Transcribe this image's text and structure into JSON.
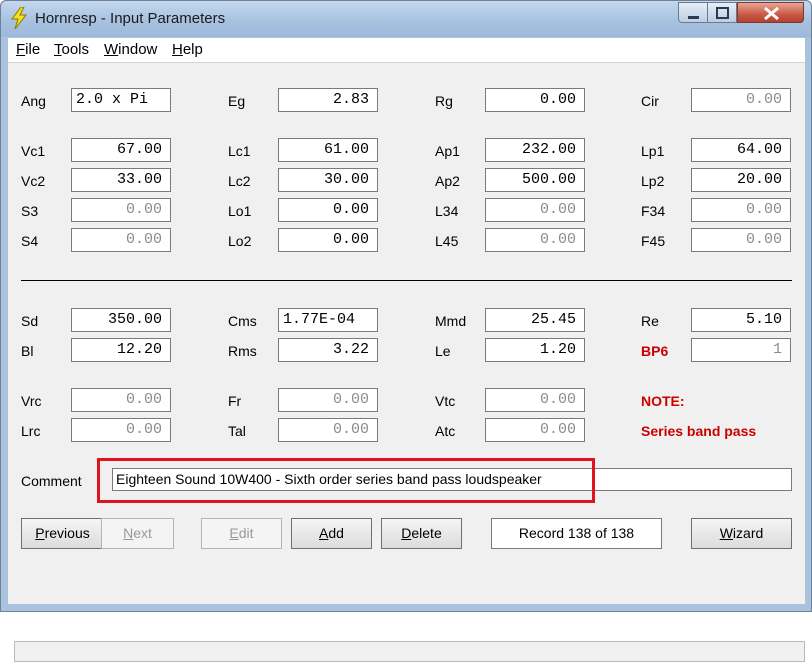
{
  "window": {
    "title": "Hornresp - Input Parameters"
  },
  "menu": [
    {
      "accel": "F",
      "rest": "ile"
    },
    {
      "accel": "T",
      "rest": "ools"
    },
    {
      "accel": "W",
      "rest": "indow"
    },
    {
      "accel": "H",
      "rest": "elp"
    }
  ],
  "params": {
    "Ang": {
      "label": "Ang",
      "value": "2.0 x Pi"
    },
    "Eg": {
      "label": "Eg",
      "value": "2.83"
    },
    "Rg": {
      "label": "Rg",
      "value": "0.00"
    },
    "Cir": {
      "label": "Cir",
      "value": "0.00"
    },
    "Vc1": {
      "label": "Vc1",
      "value": "67.00"
    },
    "Lc1": {
      "label": "Lc1",
      "value": "61.00"
    },
    "Ap1": {
      "label": "Ap1",
      "value": "232.00"
    },
    "Lp1": {
      "label": "Lp1",
      "value": "64.00"
    },
    "Vc2": {
      "label": "Vc2",
      "value": "33.00"
    },
    "Lc2": {
      "label": "Lc2",
      "value": "30.00"
    },
    "Ap2": {
      "label": "Ap2",
      "value": "500.00"
    },
    "Lp2": {
      "label": "Lp2",
      "value": "20.00"
    },
    "S3": {
      "label": "S3",
      "value": "0.00"
    },
    "Lo1": {
      "label": "Lo1",
      "value": "0.00"
    },
    "L34": {
      "label": "L34",
      "value": "0.00"
    },
    "F34": {
      "label": "F34",
      "value": "0.00"
    },
    "S4": {
      "label": "S4",
      "value": "0.00"
    },
    "Lo2": {
      "label": "Lo2",
      "value": "0.00"
    },
    "L45": {
      "label": "L45",
      "value": "0.00"
    },
    "F45": {
      "label": "F45",
      "value": "0.00"
    },
    "Sd": {
      "label": "Sd",
      "value": "350.00"
    },
    "Cms": {
      "label": "Cms",
      "value": "1.77E-04"
    },
    "Mmd": {
      "label": "Mmd",
      "value": "25.45"
    },
    "Re": {
      "label": "Re",
      "value": "5.10"
    },
    "Bl": {
      "label": "Bl",
      "value": "12.20"
    },
    "Rms": {
      "label": "Rms",
      "value": "3.22"
    },
    "Le": {
      "label": "Le",
      "value": "1.20"
    },
    "BP6": {
      "label": "BP6",
      "value": "1"
    },
    "Vrc": {
      "label": "Vrc",
      "value": "0.00"
    },
    "Fr": {
      "label": "Fr",
      "value": "0.00"
    },
    "Vtc": {
      "label": "Vtc",
      "value": "0.00"
    },
    "Lrc": {
      "label": "Lrc",
      "value": "0.00"
    },
    "Tal": {
      "label": "Tal",
      "value": "0.00"
    },
    "Atc": {
      "label": "Atc",
      "value": "0.00"
    }
  },
  "note": {
    "heading": "NOTE:",
    "text": "Series band pass"
  },
  "comment": {
    "label": "Comment",
    "value": "Eighteen Sound 10W400 - Sixth order series band pass loudspeaker"
  },
  "buttons": {
    "previous": {
      "accel": "P",
      "rest": "revious"
    },
    "next": {
      "accel": "N",
      "rest": "ext"
    },
    "edit": {
      "accel": "E",
      "rest": "dit"
    },
    "add": {
      "accel": "A",
      "rest": "dd"
    },
    "delete": {
      "accel": "D",
      "rest": "elete"
    },
    "wizard": {
      "accel": "W",
      "rest": "izard"
    }
  },
  "record": "Record 138 of 138",
  "colors": {
    "accent_red": "#cc0000",
    "highlight_box": "#e0141e",
    "titlebar": "#a9c3df"
  },
  "icons": [
    "lightning-bolt-icon",
    "minimize-icon",
    "maximize-icon",
    "close-icon"
  ]
}
